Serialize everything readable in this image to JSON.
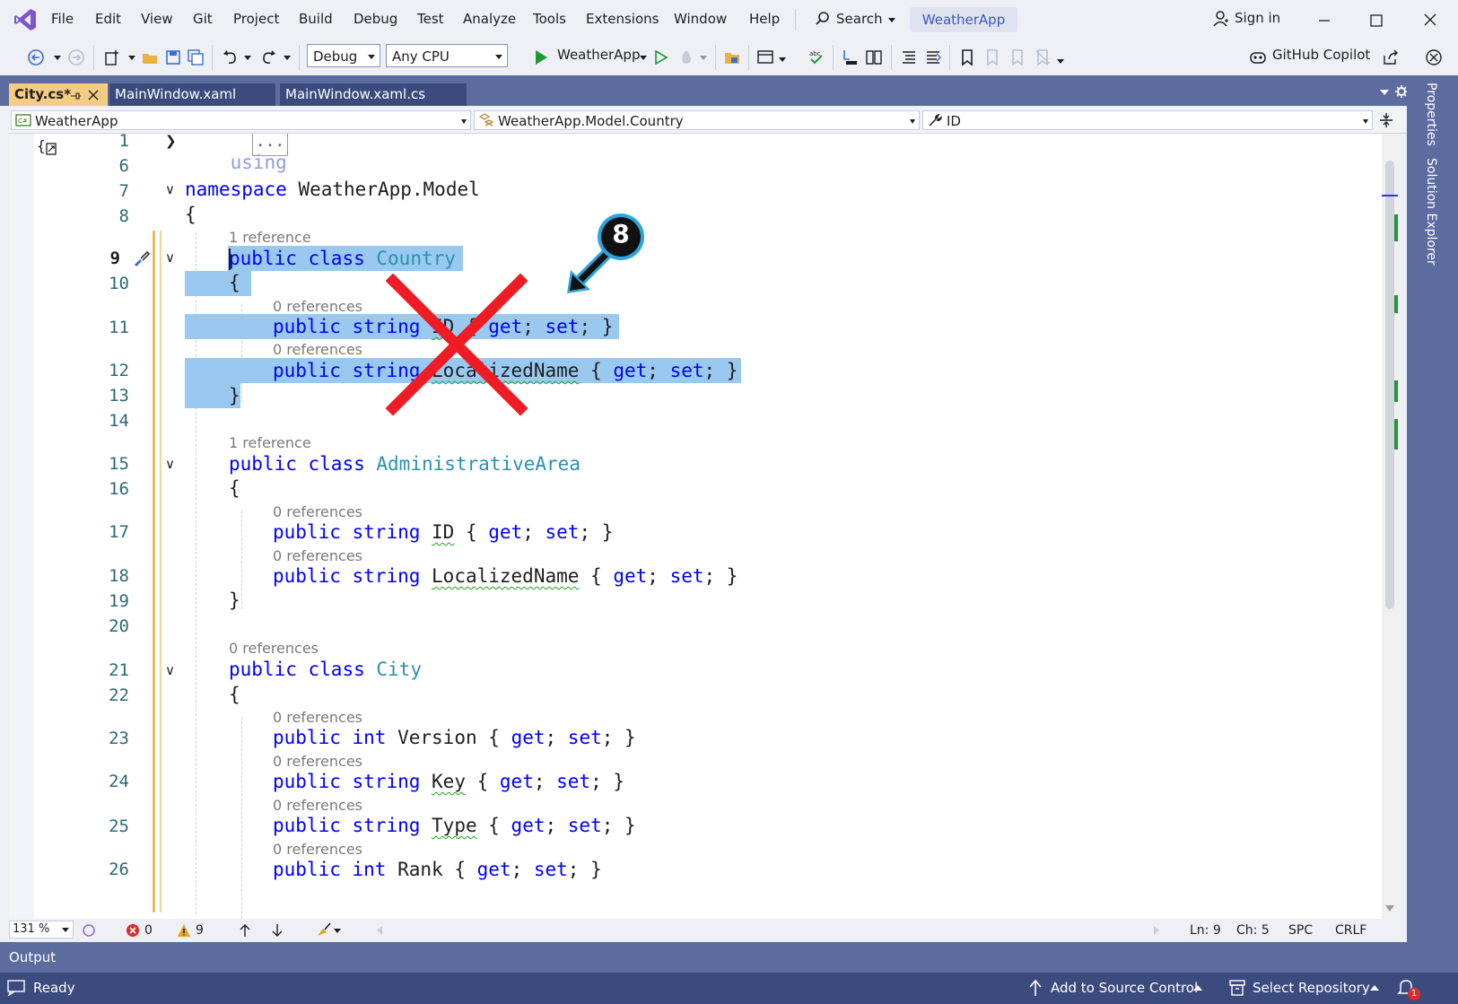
{
  "menu": {
    "items": [
      "File",
      "Edit",
      "View",
      "Git",
      "Project",
      "Build",
      "Debug",
      "Test",
      "Analyze",
      "Tools",
      "Extensions",
      "Window",
      "Help"
    ],
    "search_label": "Search",
    "project_name": "WeatherApp",
    "sign_in": "Sign in"
  },
  "toolbar": {
    "config": "Debug",
    "platform": "Any CPU",
    "run_target": "WeatherApp",
    "copilot": "GitHub Copilot"
  },
  "tabs": [
    {
      "label": "City.cs*",
      "active": true
    },
    {
      "label": "MainWindow.xaml",
      "active": false
    },
    {
      "label": "MainWindow.xaml.cs",
      "active": false
    }
  ],
  "navbar": {
    "project": "WeatherApp",
    "type": "WeatherApp.Model.Country",
    "member": "ID"
  },
  "side_panels": [
    "Properties",
    "Solution Explorer"
  ],
  "callout": {
    "number": "8"
  },
  "code": {
    "l1": "1",
    "l6": "6",
    "l7": "7",
    "l8": "8",
    "l9": "9",
    "l10": "10",
    "l11": "11",
    "l12": "12",
    "l13": "13",
    "l14": "14",
    "l15": "15",
    "l16": "16",
    "l17": "17",
    "l18": "18",
    "l19": "19",
    "l20": "20",
    "l21": "21",
    "l22": "22",
    "l23": "23",
    "l24": "24",
    "l25": "25",
    "l26": "26",
    "using": "using",
    "ellipsis": "...",
    "namespace_kw": "namespace",
    "namespace_name": "WeatherApp.Model",
    "open": "{",
    "close": "}",
    "public": "public",
    "class": "class",
    "string": "string",
    "int": "int",
    "get": "get",
    "set": "set",
    "country": "Country",
    "admin": "AdministrativeArea",
    "city": "City",
    "id": "ID",
    "localized": "LocalizedName",
    "version": "Version",
    "key": "Key",
    "type": "Type",
    "rank": "Rank",
    "ref1": "1 reference",
    "ref0": "0 references"
  },
  "editor_status": {
    "zoom": "131 %",
    "errors": "0",
    "warnings": "9",
    "ln": "Ln: 9",
    "ch": "Ch: 5",
    "spc": "SPC",
    "crlf": "CRLF"
  },
  "output_label": "Output",
  "status": {
    "ready": "Ready",
    "add_source": "Add to Source Control",
    "select_repo": "Select Repository",
    "notifications": "1"
  },
  "colors": {
    "keyword": "#0000ff",
    "type": "#2b91af",
    "selection": "#99c9ef",
    "accent": "#5c6c9f",
    "active_tab": "#f5cc84",
    "cross": "#ee1c24"
  }
}
